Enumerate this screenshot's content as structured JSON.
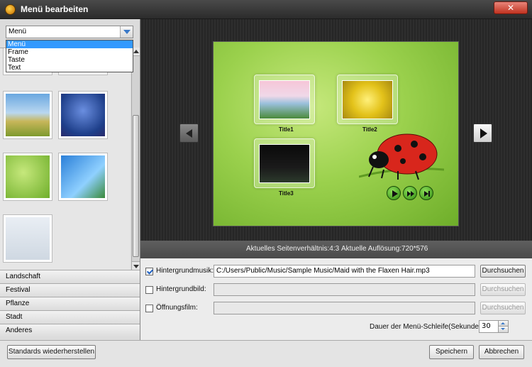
{
  "window": {
    "title": "Menü bearbeiten",
    "close_label": "✕"
  },
  "template_select": {
    "value": "Menü",
    "options": [
      "Menü",
      "Frame",
      "Taste",
      "Text"
    ]
  },
  "categories": [
    "Landschaft",
    "Festival",
    "Pflanze",
    "Stadt",
    "Anderes"
  ],
  "preview": {
    "titles": [
      "Title1",
      "Title2",
      "Title3"
    ]
  },
  "status": {
    "aspect_ratio": "Aktuelles Seitenverhältnis:4:3",
    "resolution": "Aktuelle Auflösung:720*576"
  },
  "settings": {
    "bg_music": {
      "label": "Hintergrundmusik:",
      "checked": true,
      "value": "C:/Users/Public/Music/Sample Music/Maid with the Flaxen Hair.mp3",
      "button": "Durchsuchen"
    },
    "bg_image": {
      "label": "Hintergrundbild:",
      "checked": false,
      "value": "",
      "button": "Durchsuchen"
    },
    "opening_film": {
      "label": "Öffnungsfilm:",
      "checked": false,
      "value": "",
      "button": "Durchsuchen"
    },
    "loop_duration": {
      "label": "Dauer der Menü-Schleife(Sekunde):",
      "value": "30"
    }
  },
  "footer": {
    "reset_label": "Standards wiederherstellen",
    "save_label": "Speichern",
    "cancel_label": "Abbrechen"
  }
}
